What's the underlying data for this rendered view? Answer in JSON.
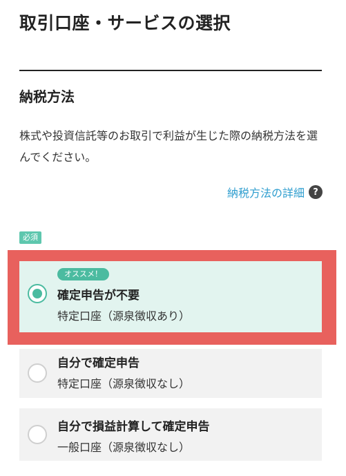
{
  "page_title": "取引口座・サービスの選択",
  "section": {
    "title": "納税方法",
    "description": "株式や投資信託等のお取引で利益が生じた際の納税方法を選んでください。",
    "details_link": "納税方法の詳細",
    "help_icon": "question-circle-icon",
    "required_label": "必須"
  },
  "options": [
    {
      "badge": "オススメ！",
      "title": "確定申告が不要",
      "subtitle": "特定口座（源泉徴収あり）",
      "selected": true
    },
    {
      "title": "自分で確定申告",
      "subtitle": "特定口座（源泉徴収なし）",
      "selected": false
    },
    {
      "title": "自分で損益計算して確定申告",
      "subtitle": "一般口座（源泉徴収なし）",
      "selected": false
    }
  ],
  "colors": {
    "accent": "#4bbba0",
    "selected_background": "#e2f4ef",
    "highlight_frame": "#e8615d",
    "link": "#2f9ecf"
  }
}
